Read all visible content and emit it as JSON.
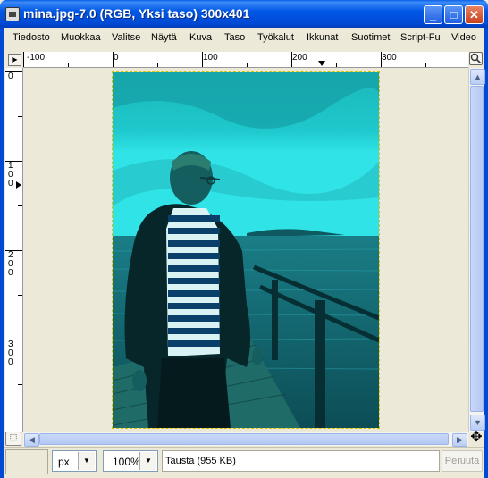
{
  "window": {
    "title": "mina.jpg-7.0 (RGB, Yksi taso) 300x401",
    "minimize_glyph": "_",
    "maximize_glyph": "□",
    "close_glyph": "✕"
  },
  "menu": [
    "Tiedosto",
    "Muokkaa",
    "Valitse",
    "Näytä",
    "Kuva",
    "Taso",
    "Työkalut",
    "Ikkunat",
    "Suotimet",
    "Script-Fu",
    "Video"
  ],
  "rulers": {
    "horizontal_labels": [
      "-100",
      "0",
      "100",
      "200",
      "300"
    ],
    "vertical_labels": [
      "0",
      "100",
      "200",
      "300"
    ]
  },
  "status": {
    "unit": "px",
    "zoom": "100%",
    "message": "Tausta (955 KB)",
    "cancel_label": "Peruuta"
  },
  "icons": {
    "app": "gimp-image-icon",
    "ruler_corner": "menu-arrow-icon",
    "zoom_toggle": "zoom-icon",
    "quick_mask": "quick-mask-icon",
    "navigate": "navigate-icon"
  }
}
